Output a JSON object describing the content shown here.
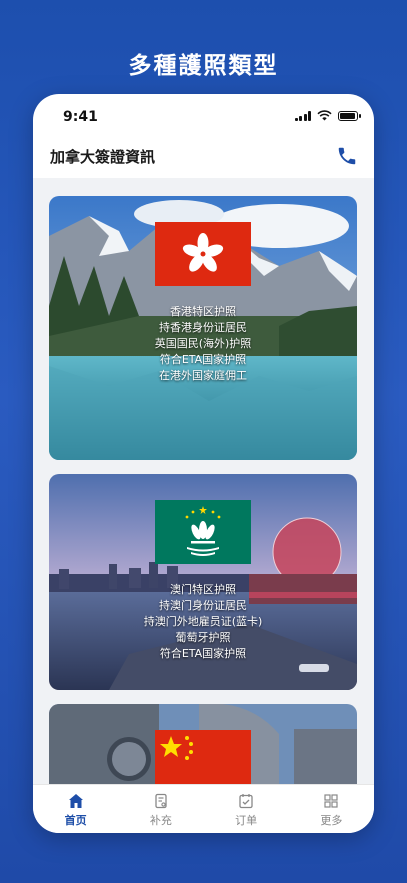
{
  "promo": {
    "title": "多種護照類型"
  },
  "status": {
    "time": "9:41"
  },
  "nav": {
    "title": "加拿大簽證資訊",
    "phone_icon": "phone-icon"
  },
  "cards": [
    {
      "flag": "hong-kong-flag",
      "lines": [
        "香港特区护照",
        "持香港身份证居民",
        "英国国民(海外)护照",
        "符合ETA国家护照",
        "在港外国家庭佣工"
      ]
    },
    {
      "flag": "macau-flag",
      "lines": [
        "澳门特区护照",
        "持澳门身份证居民",
        "持澳门外地雇员证(蓝卡)",
        "葡萄牙护照",
        "符合ETA国家护照"
      ]
    },
    {
      "flag": "china-flag",
      "lines": []
    }
  ],
  "tabs": [
    {
      "label": "首页",
      "icon": "home-icon",
      "active": true
    },
    {
      "label": "补充",
      "icon": "document-icon",
      "active": false
    },
    {
      "label": "订单",
      "icon": "order-icon",
      "active": false
    },
    {
      "label": "更多",
      "icon": "grid-icon",
      "active": false
    }
  ],
  "colors": {
    "brand": "#1e4ea8",
    "background": "#2a5bc0"
  }
}
